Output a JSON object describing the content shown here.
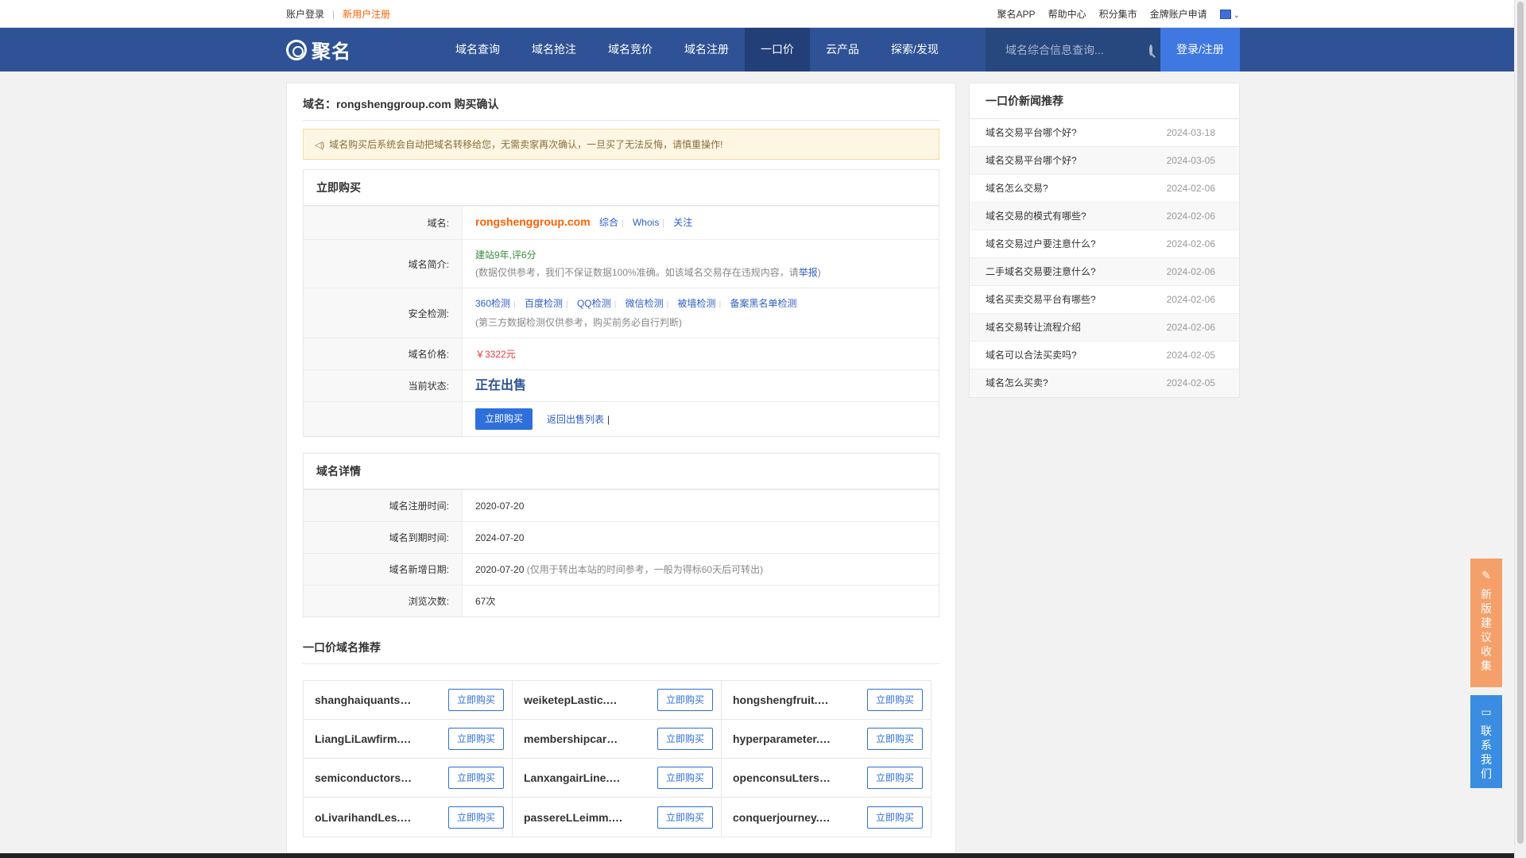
{
  "topbar": {
    "login": "账户登录",
    "separator": "|",
    "register": "新用户注册",
    "links": [
      "聚名APP",
      "帮助中心",
      "积分集市",
      "金牌账户申请"
    ]
  },
  "nav": {
    "logo_text": "聚名",
    "menu": [
      "域名查询",
      "域名抢注",
      "域名竞价",
      "域名注册",
      "一口价",
      "云产品",
      "探索/发现"
    ],
    "active_index": 4,
    "search_placeholder": "域名综合信息查询...",
    "login_button": "登录/注册"
  },
  "main": {
    "title": "域名：rongshenggroup.com 购买确认",
    "notice": "域名购买后系统会自动把域名转移给您，无需卖家再次确认，一旦买了无法反悔，请慎重操作!",
    "buy_panel": {
      "heading": "立即购买",
      "domain_label": "域名:",
      "domain": "rongshenggroup.com",
      "domain_links": [
        "综合",
        "Whois",
        "关注"
      ],
      "intro_label": "域名简介:",
      "intro": "建站9年,评6分",
      "intro_note_prefix": "(数据仅供参考，我们不保证数据100%准确。如该域名交易存在违规内容，请",
      "intro_note_link": "举报",
      "intro_note_suffix": ")",
      "security_label": "安全检测:",
      "security_links": [
        "360检测",
        "百度检测",
        "QQ检测",
        "微信检测",
        "被墙检测",
        "备案黑名单检测"
      ],
      "security_note": "(第三方数据检测仅供参考，购买前务必自行判断)",
      "price_label": "域名价格:",
      "price": "￥3322元",
      "status_label": "当前状态:",
      "status": "正在出售",
      "buy_button": "立即购买",
      "back_link": "返回出售列表"
    },
    "details_panel": {
      "heading": "域名详情",
      "reg_label": "域名注册时间:",
      "reg_date": "2020-07-20",
      "exp_label": "域名到期时间:",
      "exp_date": "2024-07-20",
      "add_label": "域名新增日期:",
      "add_date": "2020-07-20",
      "add_note": "(仅用于转出本站的时间参考，一般为得标60天后可转出)",
      "views_label": "浏览次数:",
      "views": "67次"
    },
    "recommend": {
      "heading": "一口价域名推荐",
      "button": "立即购买",
      "items": [
        "shanghaiquants.com",
        "weiketepLastic.com",
        "hongshengfruit.com",
        "LiangLiLawfirm.com",
        "membershipcard.com",
        "hyperparameter.com",
        "semiconductors.com",
        "LanxangairLine.com",
        "openconsuLters.com",
        "oLivarihandLes.com",
        "passereLLeimm.com",
        "conquerjourney.com"
      ]
    }
  },
  "side": {
    "heading": "一口价新闻推荐",
    "news": [
      {
        "title": "域名交易平台哪个好?",
        "date": "2024-03-18"
      },
      {
        "title": "域名交易平台哪个好?",
        "date": "2024-03-05"
      },
      {
        "title": "域名怎么交易?",
        "date": "2024-02-06"
      },
      {
        "title": "域名交易的模式有哪些?",
        "date": "2024-02-06"
      },
      {
        "title": "域名交易过户要注意什么?",
        "date": "2024-02-06"
      },
      {
        "title": "二手域名交易要注意什么?",
        "date": "2024-02-06"
      },
      {
        "title": "域名买卖交易平台有哪些?",
        "date": "2024-02-06"
      },
      {
        "title": "域名交易转让流程介绍",
        "date": "2024-02-06"
      },
      {
        "title": "域名可以合法买卖吗?",
        "date": "2024-02-05"
      },
      {
        "title": "域名怎么买卖?",
        "date": "2024-02-05"
      }
    ]
  },
  "floating": {
    "feedback": "新版建议收集",
    "contact": "联系我们"
  }
}
